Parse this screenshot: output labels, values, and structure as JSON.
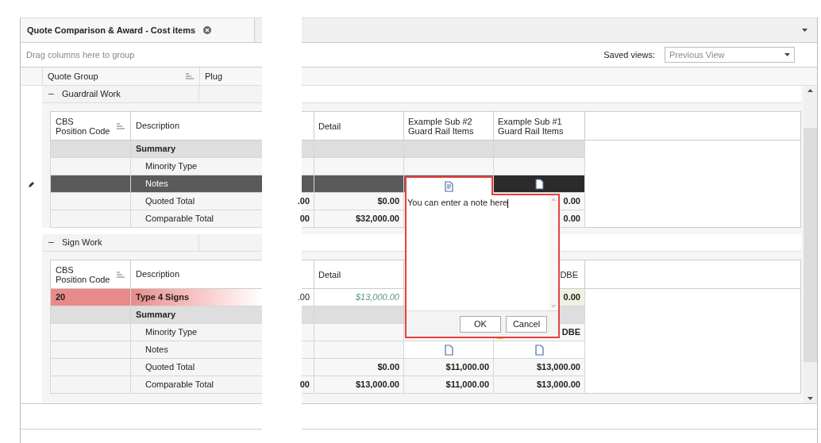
{
  "tab": {
    "title": "Quote Comparison & Award - Cost items"
  },
  "group_panel": {
    "hint": "Drag columns here to group",
    "saved_views_label": "Saved views:",
    "saved_views_value": "Previous View"
  },
  "columns": [
    "Quote Group",
    "Plug"
  ],
  "groups": [
    {
      "title": "Guardrail Work",
      "expanded": true,
      "header": {
        "code": [
          "CBS",
          "Position Code"
        ],
        "description": "Description",
        "cells": [
          {
            "kind": "blank"
          },
          {
            "kind": "full",
            "lines": [
              "Detail"
            ]
          },
          {
            "kind": "full",
            "lines": [
              "Example Sub #2",
              "Guard Rail Items"
            ]
          },
          {
            "kind": "full",
            "lines": [
              "Example Sub #1",
              "Guard Rail Items"
            ]
          }
        ]
      },
      "rows": [
        {
          "kind": "summary",
          "selected": false,
          "code": "",
          "description": "Summary",
          "cells": [
            {
              "kind": "empty"
            },
            {
              "kind": "empty"
            },
            {
              "kind": "empty"
            },
            {
              "kind": "empty"
            }
          ]
        },
        {
          "kind": "detail",
          "selected": false,
          "code": "",
          "description": "Minority Type",
          "cells": [
            {
              "kind": "empty"
            },
            {
              "kind": "empty"
            },
            {
              "kind": "empty"
            },
            {
              "kind": "empty"
            }
          ]
        },
        {
          "kind": "detail",
          "selected": true,
          "code": "",
          "description": "Notes",
          "cells": [
            {
              "kind": "empty"
            },
            {
              "kind": "empty"
            },
            {
              "kind": "empty"
            },
            {
              "kind": "note"
            }
          ]
        },
        {
          "kind": "detail",
          "selected": false,
          "code": "",
          "description": "Quoted Total",
          "cells": [
            {
              "kind": "text",
              "text": ".00"
            },
            {
              "kind": "text",
              "text": "$0.00"
            },
            {
              "kind": "empty"
            },
            {
              "kind": "text",
              "text": "0.00"
            }
          ]
        },
        {
          "kind": "detail",
          "selected": false,
          "code": "",
          "description": "Comparable Total",
          "cells": [
            {
              "kind": "text",
              "text": "00"
            },
            {
              "kind": "text",
              "text": "$32,000.00"
            },
            {
              "kind": "empty"
            },
            {
              "kind": "text",
              "text": "0.00"
            }
          ]
        }
      ]
    },
    {
      "title": "Sign Work",
      "expanded": true,
      "header": {
        "code": [
          "CBS",
          "Position Code"
        ],
        "description": "Description",
        "cells": [
          {
            "kind": "blank"
          },
          {
            "kind": "full",
            "lines": [
              "Detail"
            ]
          },
          {
            "kind": "blank"
          },
          {
            "kind": "partial",
            "lines": [
              "DBE"
            ]
          }
        ]
      },
      "rows": [
        {
          "kind": "item",
          "selected": false,
          "code": "20",
          "description": "Type 4 Signs",
          "cells": [
            {
              "kind": "plain",
              "text": ".00"
            },
            {
              "kind": "estimate",
              "text": "$13,000.00"
            },
            {
              "kind": "empty"
            },
            {
              "kind": "best",
              "text": "0.00"
            }
          ]
        },
        {
          "kind": "summary",
          "selected": false,
          "code": "",
          "description": "Summary",
          "cells": [
            {
              "kind": "empty"
            },
            {
              "kind": "empty"
            },
            {
              "kind": "empty"
            },
            {
              "kind": "empty"
            }
          ]
        },
        {
          "kind": "detail",
          "selected": false,
          "code": "",
          "description": "Minority Type",
          "cells": [
            {
              "kind": "empty"
            },
            {
              "kind": "empty"
            },
            {
              "kind": "empty"
            },
            {
              "kind": "flagged",
              "text": "DBE"
            }
          ]
        },
        {
          "kind": "detail",
          "selected": false,
          "code": "",
          "description": "Notes",
          "cells": [
            {
              "kind": "empty"
            },
            {
              "kind": "empty"
            },
            {
              "kind": "note"
            },
            {
              "kind": "note"
            }
          ]
        },
        {
          "kind": "detail",
          "selected": false,
          "code": "",
          "description": "Quoted Total",
          "cells": [
            {
              "kind": "empty"
            },
            {
              "kind": "text",
              "text": "$0.00"
            },
            {
              "kind": "text",
              "text": "$11,000.00"
            },
            {
              "kind": "text",
              "text": "$13,000.00"
            }
          ]
        },
        {
          "kind": "detail",
          "selected": false,
          "code": "",
          "description": "Comparable Total",
          "cells": [
            {
              "kind": "text",
              "text": "00"
            },
            {
              "kind": "text",
              "text": "$13,000.00"
            },
            {
              "kind": "text",
              "text": "$11,000.00"
            },
            {
              "kind": "text",
              "text": "$13,000.00"
            }
          ]
        }
      ]
    }
  ],
  "note_popup": {
    "text": "You can enter a note here",
    "buttons": [
      "OK",
      "Cancel"
    ]
  }
}
